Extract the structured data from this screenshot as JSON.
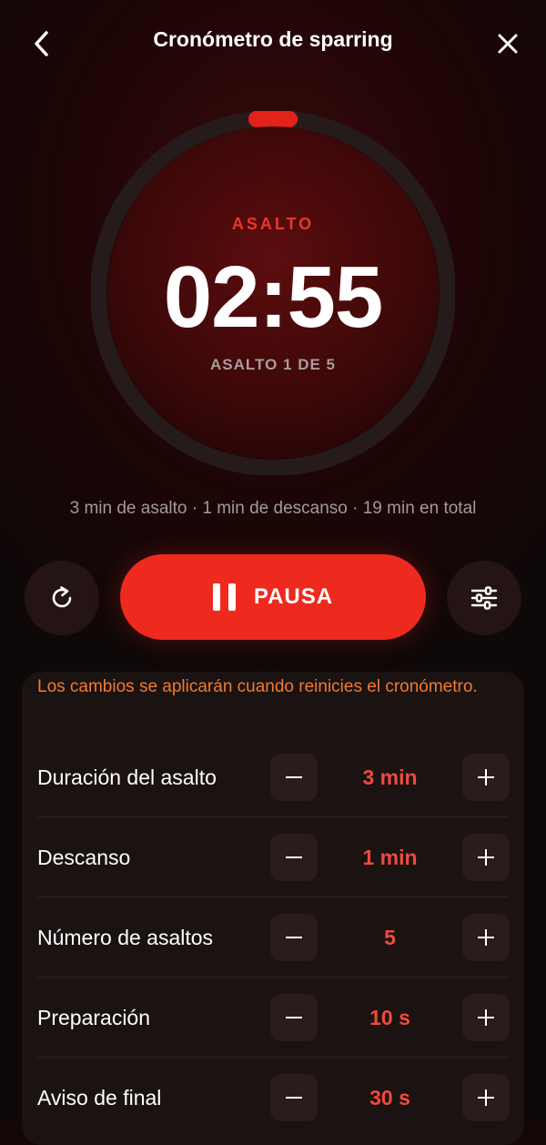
{
  "header": {
    "title": "Cronómetro de sparring",
    "back_icon": "chevron-left-icon",
    "close_icon": "close-icon"
  },
  "timer": {
    "label": "ASALTO",
    "time": "02:55",
    "round_info": "ASALTO 1 DE 5",
    "progress_remaining": 0.97
  },
  "summary": "3 min de asalto · 1 min de descanso · 19 min en total",
  "controls": {
    "reset_icon": "refresh-icon",
    "pause_label": "PAUSA",
    "pause_icon": "pause-icon",
    "settings_icon": "sliders-icon"
  },
  "settings": {
    "notice": "Los cambios se aplicarán cuando reinicies el cronómetro.",
    "rows": [
      {
        "label": "Duración del asalto",
        "value": "3 min"
      },
      {
        "label": "Descanso",
        "value": "1 min"
      },
      {
        "label": "Número de asaltos",
        "value": "5"
      },
      {
        "label": "Preparación",
        "value": "10 s"
      },
      {
        "label": "Aviso de final",
        "value": "30 s"
      }
    ]
  },
  "colors": {
    "accent": "#ee2a1f",
    "value": "#ef4a3c",
    "notice": "#f07b2c"
  }
}
